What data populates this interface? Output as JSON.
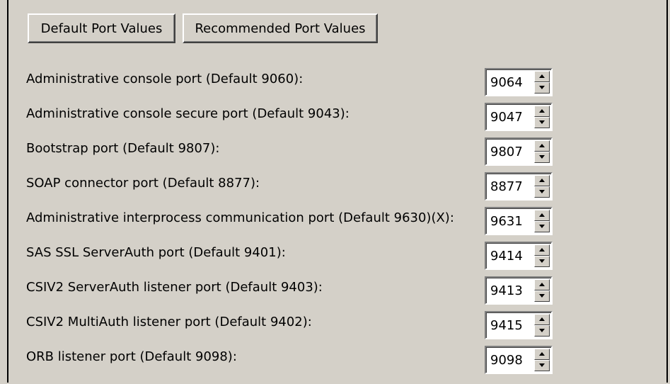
{
  "buttons": {
    "default_port_values": "Default Port Values",
    "recommended_port_values": "Recommended Port Values"
  },
  "ports": [
    {
      "label": "Administrative console port (Default 9060):",
      "value": "9064"
    },
    {
      "label": "Administrative console secure port (Default 9043):",
      "value": "9047"
    },
    {
      "label": "Bootstrap port (Default 9807):",
      "value": "9807"
    },
    {
      "label": "SOAP connector port (Default 8877):",
      "value": "8877"
    },
    {
      "label": "Administrative interprocess communication port (Default 9630)(X):",
      "value": "9631"
    },
    {
      "label": "SAS SSL ServerAuth port (Default 9401):",
      "value": "9414"
    },
    {
      "label": "CSIV2 ServerAuth listener port (Default 9403):",
      "value": "9413"
    },
    {
      "label": "CSIV2 MultiAuth listener port (Default 9402):",
      "value": "9415"
    },
    {
      "label": "ORB listener port (Default 9098):",
      "value": "9098"
    }
  ]
}
